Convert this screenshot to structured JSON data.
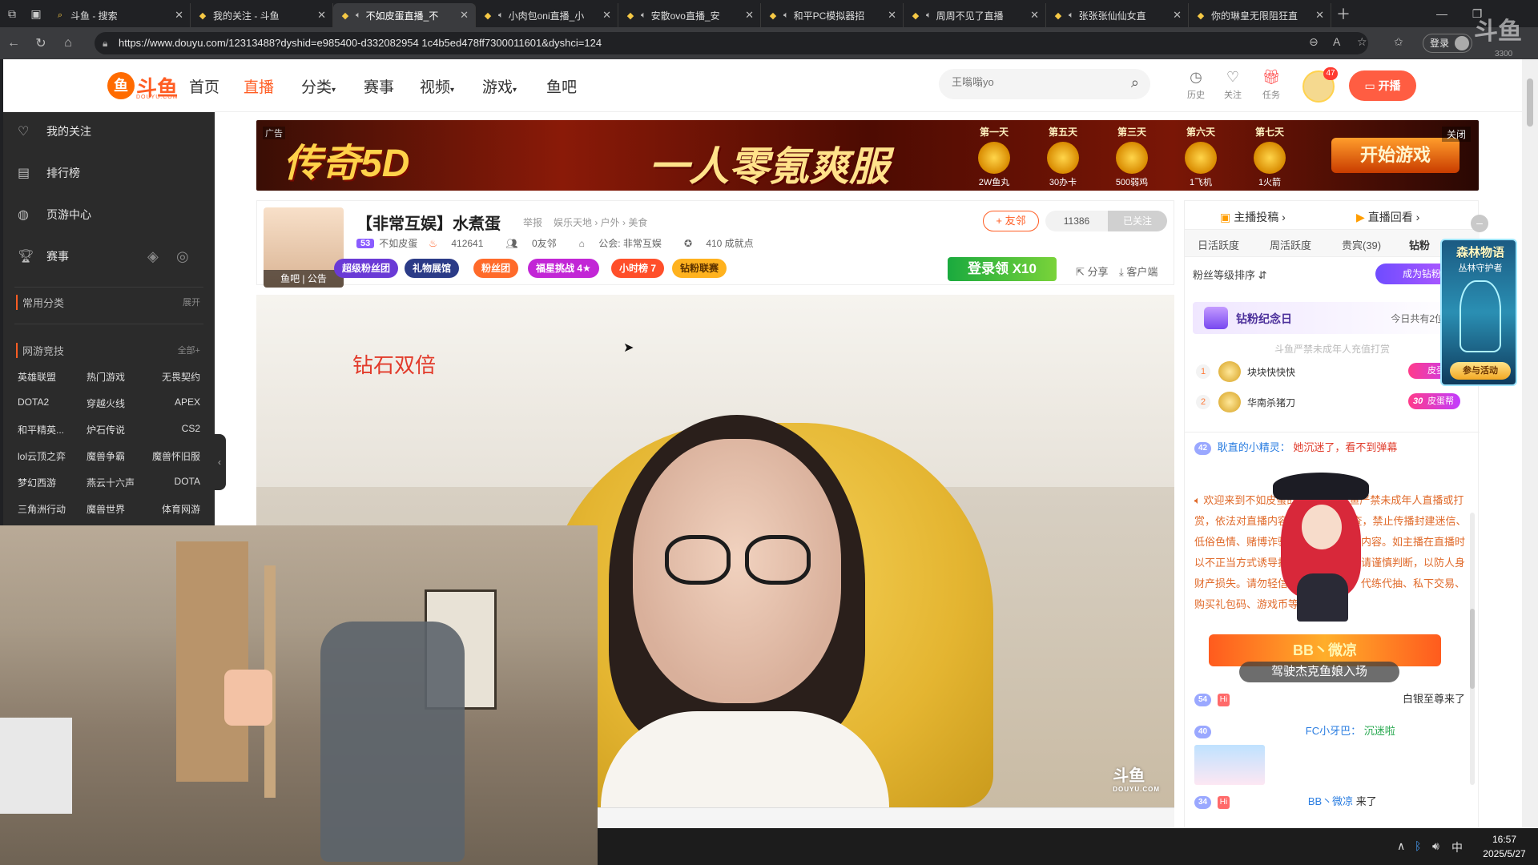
{
  "browser": {
    "tabs": [
      {
        "title": "斗鱼 - 搜索",
        "active": false,
        "audio": false
      },
      {
        "title": "我的关注 - 斗鱼",
        "active": false,
        "audio": false
      },
      {
        "title": "不如皮蛋直播_不",
        "active": true,
        "audio": true
      },
      {
        "title": "小肉包oni直播_小",
        "active": false,
        "audio": true
      },
      {
        "title": "安散ovo直播_安",
        "active": false,
        "audio": true
      },
      {
        "title": "和平PC模拟器招",
        "active": false,
        "audio": true
      },
      {
        "title": "周周不见了直播",
        "active": false,
        "audio": true
      },
      {
        "title": "张张张仙仙女直",
        "active": false,
        "audio": true
      },
      {
        "title": "你的琳皇无限阻狂直",
        "active": false,
        "audio": false
      }
    ],
    "url": "https://www.douyu.com/12313488?dyshid=e985400-d332082954 1c4b5ed478ff7300011601&dyshci=124",
    "login_label": "登录"
  },
  "site": {
    "logo_text": "斗鱼",
    "logo_sub": "DOUYU.COM",
    "nav": [
      "首页",
      "直播",
      "分类",
      "赛事",
      "视频",
      "游戏",
      "鱼吧"
    ],
    "active_nav": "直播",
    "search_placeholder": "王嗡嗡yo",
    "header_items": [
      {
        "label": "历史",
        "icon": "clock-icon"
      },
      {
        "label": "关注",
        "icon": "heart-icon"
      },
      {
        "label": "任务",
        "icon": "gift-icon"
      }
    ],
    "avatar_badge": "47",
    "kaibo_label": "开播"
  },
  "sidebar": {
    "items": [
      {
        "label": "我的关注",
        "icon": "heart-icon"
      },
      {
        "label": "排行榜",
        "icon": "rank-icon"
      },
      {
        "label": "页游中心",
        "icon": "gamepad-icon"
      },
      {
        "label": "赛事",
        "icon": "trophy-icon"
      }
    ],
    "common_head": "常用分类",
    "common_more": "展开",
    "net_head": "网游竞技",
    "net_more": "全部+",
    "games": [
      [
        "英雄联盟",
        "热门游戏",
        "无畏契约"
      ],
      [
        "DOTA2",
        "穿越火线",
        "APEX"
      ],
      [
        "和平精英...",
        "炉石传说",
        "CS2"
      ],
      [
        "lol云顶之弈",
        "魔兽争霸",
        "魔兽怀旧服"
      ],
      [
        "梦幻西游",
        "燕云十六声",
        "DOTA"
      ],
      [
        "三角洲行动",
        "魔兽世界",
        "体育网游"
      ]
    ]
  },
  "ad": {
    "tag": "广告",
    "close": "关闭",
    "title1": "传奇5D",
    "title2": "一人零氪爽服",
    "days": [
      {
        "day": "第一天",
        "reward": "2W鱼丸"
      },
      {
        "day": "第五天",
        "reward": "30办卡"
      },
      {
        "day": "第三天",
        "reward": "500弱鸡"
      },
      {
        "day": "第六天",
        "reward": "1飞机"
      },
      {
        "day": "第七天",
        "reward": "1火箭"
      }
    ],
    "start": "开始游戏"
  },
  "room": {
    "title": "【非常互娱】水煮蛋",
    "report": "举报",
    "category": "娱乐天地 › 户外 › 美食",
    "avatar_bar": "鱼吧 | 公告",
    "level": "53",
    "name": "不如皮蛋",
    "hot": "412641",
    "friends": "0友邻",
    "guild": "公会: 非常互娱",
    "points": "410 成就点",
    "pills": [
      "超级粉丝团",
      "礼物展馆",
      "粉丝团",
      "福星挑战 4★",
      "小时榜 7",
      "钻粉联赛"
    ],
    "yb_label": "+ 友邻",
    "fans_count": "11386",
    "followed_label": "已关注",
    "login_get": "登录领 X10",
    "share": "分享",
    "client": "客户端"
  },
  "video": {
    "overlay_text": "钻石双倍",
    "watermark": "斗鱼",
    "watermark_sub": "DOUYU.COM"
  },
  "panel": {
    "top_links": [
      "主播投稿 ›",
      "直播回看 ›"
    ],
    "tabs": [
      "日活跃度",
      "周活跃度",
      "贵宾(39)",
      "钻粉"
    ],
    "sort_label": "粉丝等级排序 ⇵",
    "cta": "成为钻粉",
    "jnr_title": "钻粉纪念日",
    "jnr_right": "今日共有2位粉丝",
    "warn": "斗鱼严禁未成年人充值打赏",
    "ranks": [
      {
        "rank": "1",
        "name": "块块快快快",
        "level": "",
        "tag": "皮蛋帮"
      },
      {
        "rank": "2",
        "name": "华南杀猪刀",
        "level": "30",
        "tag": "皮蛋帮"
      }
    ],
    "chat": {
      "line1": {
        "level": "42",
        "name": "耿直的小精灵：",
        "msg": "她沉迷了，看不到弹幕"
      },
      "sys_notice": "欢迎来到不如皮蛋的直播间。斗鱼严禁未成年人直播或打赏，依法对直播内容进行24小时巡查，禁止传播封建迷信、低俗色情、赌博诈骗等任何违法违规内容。如主播在直播时以不正当方式诱导打赏、私下交易，请谨慎判断，以防人身财产损失。请勿轻信各类招聘征婚、代练代抽、私下交易、购买礼包码、游戏币等广告信息。",
      "bb_welcome": "BB丶微凉",
      "entry_bar": "驾驶杰克鱼娘入场",
      "line2": {
        "level": "54",
        "tail": "白银至尊来了"
      },
      "line3": {
        "level": "40",
        "name": "FC小牙巴：",
        "msg": "沉迷啦"
      },
      "line4": {
        "level": "34",
        "name": "BB丶微凉",
        "msg": "来了"
      }
    }
  },
  "event": {
    "title": "森林物语",
    "sub": "丛林守护者",
    "btn": "参与活动"
  },
  "taskbar": {
    "time": "16:57",
    "date": "2025/5/27",
    "ime": "中"
  },
  "corner": {
    "wm": "斗鱼",
    "num": "3300"
  }
}
